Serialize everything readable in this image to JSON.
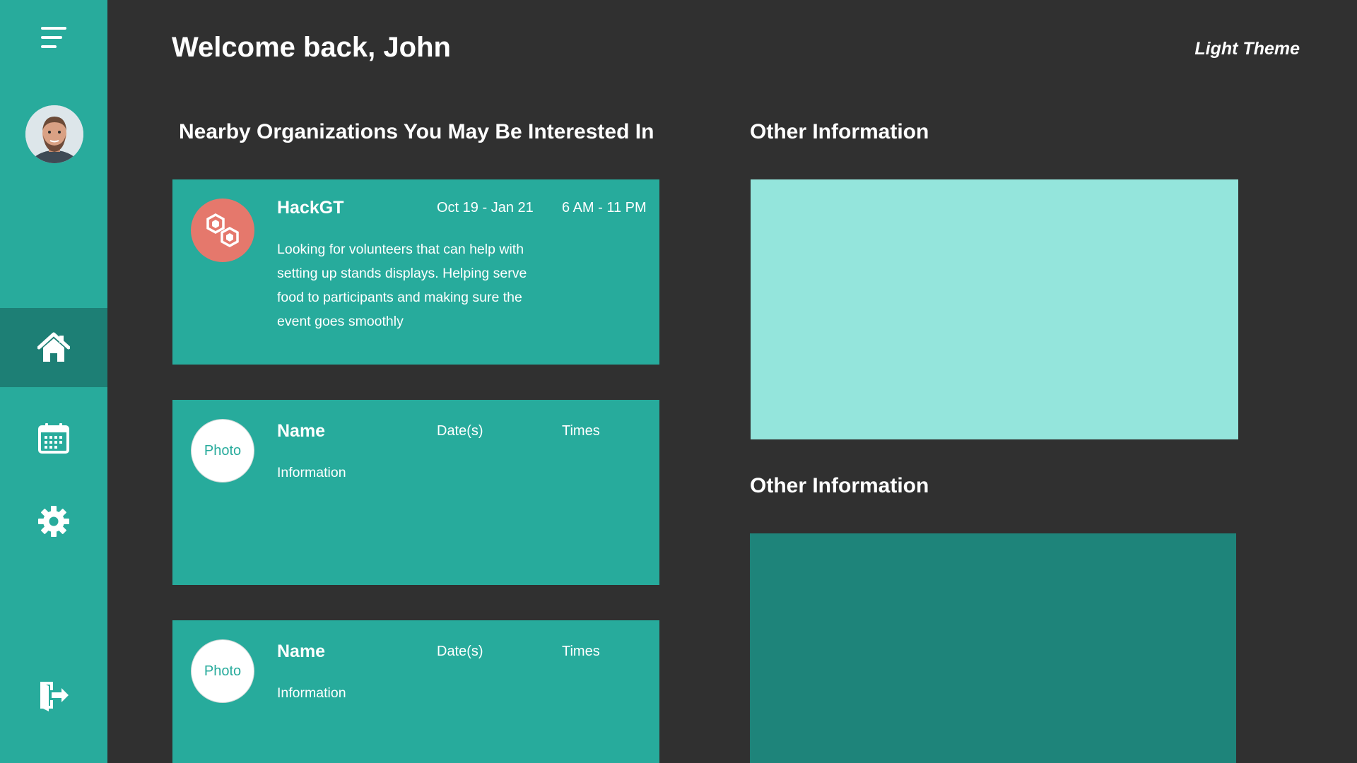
{
  "header": {
    "greeting": "Welcome back, John",
    "theme_toggle": "Light Theme"
  },
  "sidebar": {
    "items": [
      {
        "name": "menu",
        "icon": "hamburger-menu-icon",
        "active": false
      },
      {
        "name": "home",
        "icon": "home-icon",
        "active": true
      },
      {
        "name": "calendar",
        "icon": "calendar-icon",
        "active": false
      },
      {
        "name": "settings",
        "icon": "gear-icon",
        "active": false
      },
      {
        "name": "logout",
        "icon": "logout-door-icon",
        "active": false
      }
    ],
    "colors": {
      "background": "#28ab9c",
      "active": "#1d7f75"
    }
  },
  "organizations": {
    "title": "Nearby Organizations You May Be Interested In",
    "cards": [
      {
        "photo": "",
        "logo": "hexagons-logo-icon",
        "name": "HackGT",
        "dates": "Oct 19 - Jan 21",
        "times": "6 AM - 11 PM",
        "info": "Looking for volunteers that can help with setting up stands displays. Helping serve food to participants and making sure the event goes smoothly"
      },
      {
        "photo": "Photo",
        "name": "Name",
        "dates": "Date(s)",
        "times": "Times",
        "info": "Information"
      },
      {
        "photo": "Photo",
        "name": "Name",
        "dates": "Date(s)",
        "times": "Times",
        "info": "Information"
      }
    ]
  },
  "other_info": [
    {
      "title": "Other Information",
      "color": "#94e5dc"
    },
    {
      "title": "Other Information",
      "color": "#1e847a"
    }
  ],
  "colors": {
    "page_background": "#303030",
    "card": "#27ab9c",
    "logo_circle": "#e5786c"
  }
}
